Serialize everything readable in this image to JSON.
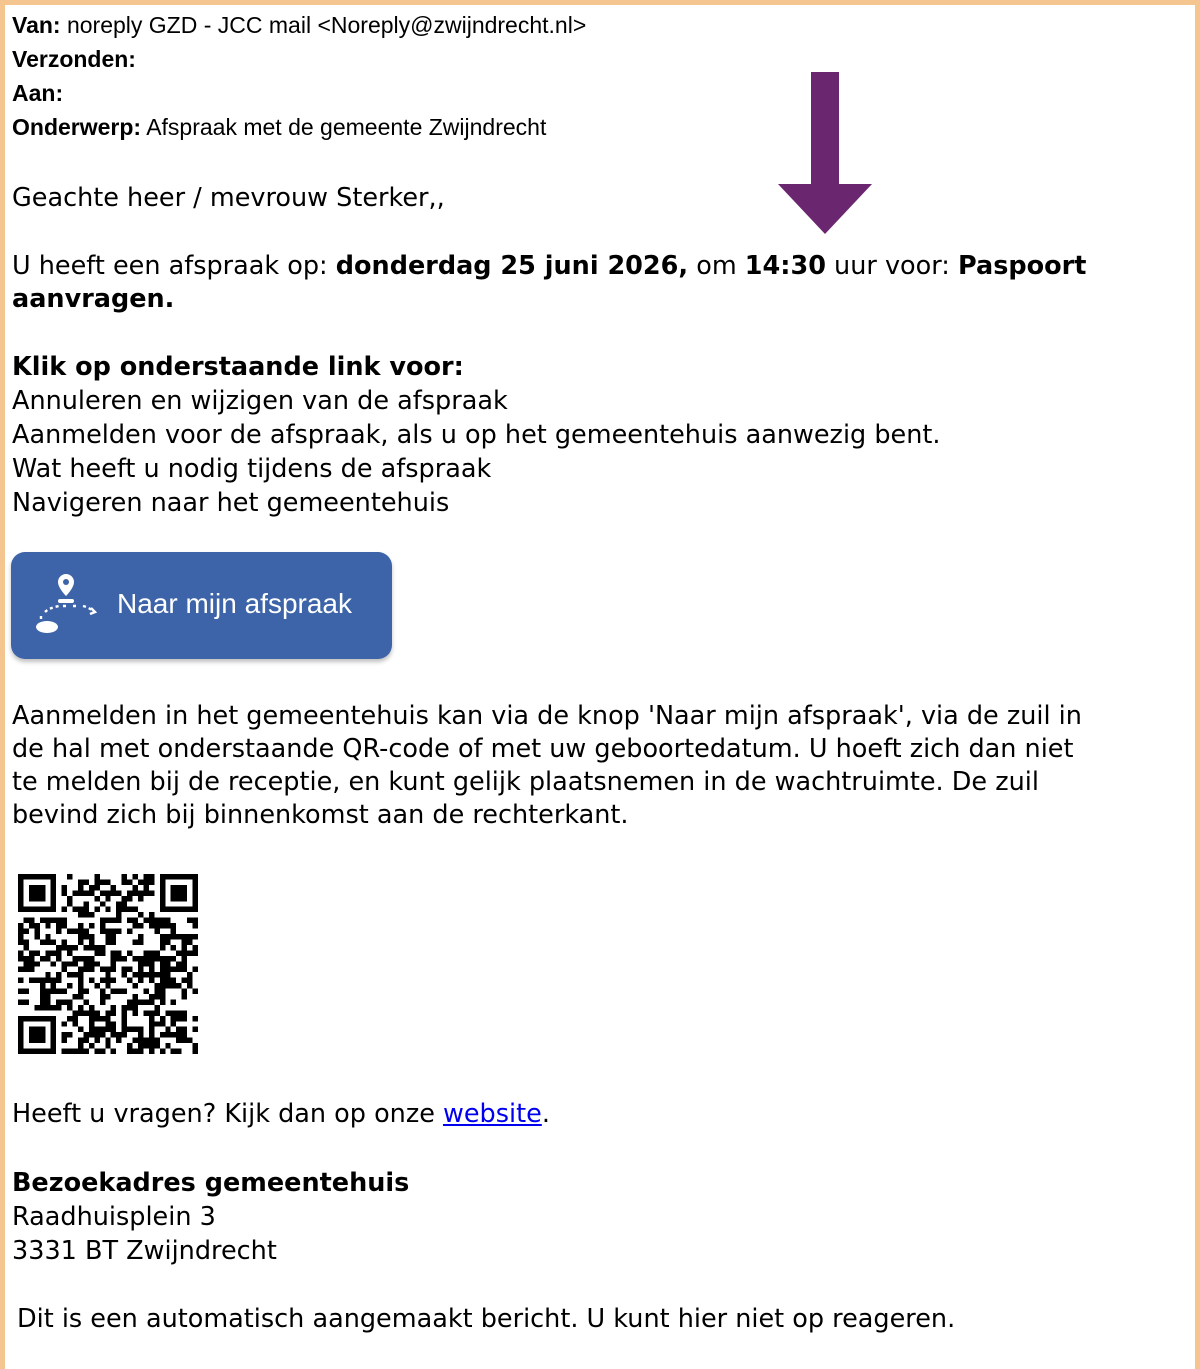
{
  "header": {
    "from_label": "Van:",
    "from_value": "noreply GZD - JCC mail <Noreply@zwijndrecht.nl>",
    "sent_label": "Verzonden:",
    "to_label": "Aan:",
    "subject_label": "Onderwerp:",
    "subject_value": "Afspraak met de gemeente Zwijndrecht"
  },
  "body": {
    "greeting": "Geachte heer / mevrouw Sterker,,",
    "appt_prefix": "U heeft een afspraak op: ",
    "appt_date": "donderdag 25 juni 2026,",
    "appt_mid": " om ",
    "appt_time": "14:30",
    "appt_mid2": " uur voor: ",
    "appt_service1": "Paspoort",
    "appt_service2": "aanvragen.",
    "links_heading": "Klik op onderstaande link voor:",
    "links": [
      "Annuleren en wijzigen van de afspraak",
      "Aanmelden voor de afspraak, als u op het gemeentehuis aanwezig bent.",
      "Wat heeft u nodig tijdens de afspraak",
      "Navigeren naar het gemeentehuis"
    ],
    "button_label": "Naar mijn afspraak",
    "checkin_lines": [
      "Aanmelden in het gemeentehuis kan via de knop 'Naar mijn afspraak', via de zuil in",
      "de hal met onderstaande QR-code of met uw geboortedatum. U hoeft zich dan niet",
      "te melden bij de receptie, en kunt gelijk plaatsnemen in de wachtruimte. De zuil",
      "bevind zich bij binnenkomst aan de rechterkant."
    ],
    "questions_prefix": "Heeft u vragen? Kijk dan op onze ",
    "questions_link": "website",
    "questions_suffix": ".",
    "address_heading": "Bezoekadres gemeentehuis",
    "address_line1": "Raadhuisplein 3",
    "address_line2": "3331 BT Zwijndrecht",
    "footer": "Dit is een automatisch aangemaakt bericht. U kunt hier niet op reageren."
  },
  "colors": {
    "frame": "#f4c58e",
    "arrow": "#6b2670",
    "button": "#3d64a8",
    "link": "#0000ee"
  },
  "icons": {
    "arrow": "down-arrow-icon",
    "button": "location-pin-icon",
    "qr": "qr-code"
  }
}
